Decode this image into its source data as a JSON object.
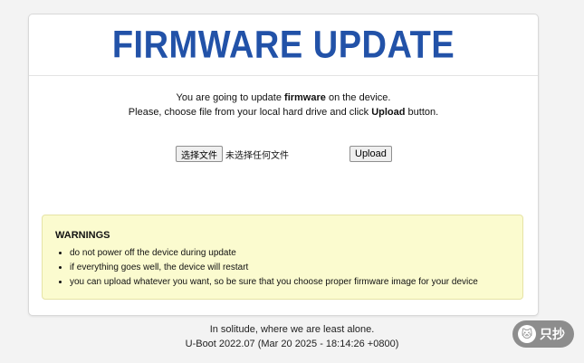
{
  "header": {
    "title": "FIRMWARE UPDATE"
  },
  "intro": {
    "line1_before": "You are going to update ",
    "line1_bold": "firmware",
    "line1_after": " on the device.",
    "line2_before": "Please, choose file from your local hard drive and click ",
    "line2_bold": "Upload",
    "line2_after": " button."
  },
  "upload": {
    "choose_label": "选择文件",
    "no_file_text": "未选择任何文件",
    "upload_label": "Upload"
  },
  "warnings": {
    "title": "WARNINGS",
    "items": [
      "do not power off the device during update",
      "if everything goes well, the device will restart",
      "you can upload whatever you want, so be sure that you choose proper firmware image for your device"
    ]
  },
  "footer": {
    "line1": "In solitude, where we are least alone.",
    "line2": "U-Boot 2022.07 (Mar 20 2025 - 18:14:26 +0800)"
  },
  "watermark": {
    "text": "只抄",
    "icon": "cat-icon"
  },
  "colors": {
    "title": "#2252a8",
    "warning_bg": "#fbfbcf",
    "page_bg": "#f3f3f3"
  }
}
